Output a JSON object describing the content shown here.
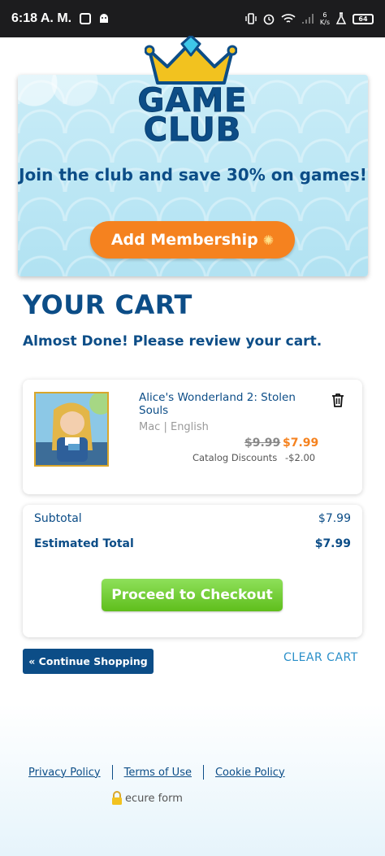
{
  "status_bar": {
    "time": "6:18 A. M.",
    "net_speed_value": "6",
    "net_speed_unit": "K/s",
    "battery": "64"
  },
  "banner": {
    "logo_line1": "GAME",
    "logo_line2": "CLUB",
    "promo_text": "Join the club and save 30% on games!",
    "membership_button": "Add Membership"
  },
  "cart": {
    "title": "YOUR CART",
    "subtitle": "Almost Done! Please review your cart.",
    "items": [
      {
        "title": "Alice's Wonderland 2: Stolen Souls",
        "meta": "Mac | English",
        "old_price": "$9.99",
        "new_price": "$7.99",
        "discount_label": "Catalog Discounts",
        "discount_value": "-$2.00"
      }
    ]
  },
  "totals": {
    "subtotal_label": "Subtotal",
    "subtotal_value": "$7.99",
    "total_label": "Estimated Total",
    "total_value": "$7.99",
    "checkout_button": "Proceed to Checkout"
  },
  "actions": {
    "continue_shopping": "« Continue Shopping",
    "clear_cart": "CLEAR CART"
  },
  "footer": {
    "privacy": "Privacy Policy",
    "terms": "Terms of Use",
    "cookie": "Cookie Policy",
    "secure": "ecure form"
  },
  "colors": {
    "brand_blue": "#0c4d87",
    "accent_orange": "#f5821f",
    "checkout_green": "#6ccb2a",
    "link_blue": "#2a8fc9"
  }
}
